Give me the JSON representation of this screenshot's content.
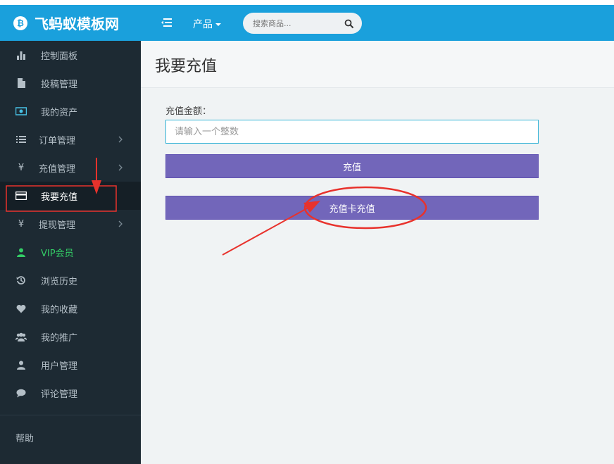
{
  "brand": {
    "logo_glyph": "₿",
    "name": "飞蚂蚁模板网"
  },
  "header": {
    "product_menu_label": "产品",
    "search": {
      "placeholder": "搜索商品...",
      "value": ""
    }
  },
  "sidebar": {
    "items": [
      {
        "label": "控制面板",
        "icon": "bar-chart-icon"
      },
      {
        "label": "投稿管理",
        "icon": "file-icon"
      },
      {
        "label": "我的资产",
        "icon": "money-icon"
      },
      {
        "label": "订单管理",
        "icon": "list-icon"
      },
      {
        "label": "充值管理",
        "icon": "yen-icon"
      },
      {
        "label": "我要充值",
        "icon": "credit-card-icon"
      },
      {
        "label": "提现管理",
        "icon": "yen-icon"
      },
      {
        "label": "VIP会员",
        "icon": "user-icon"
      },
      {
        "label": "浏览历史",
        "icon": "history-icon"
      },
      {
        "label": "我的收藏",
        "icon": "heart-icon"
      },
      {
        "label": "我的推广",
        "icon": "users-icon"
      },
      {
        "label": "用户管理",
        "icon": "user-icon"
      },
      {
        "label": "评论管理",
        "icon": "comment-icon"
      }
    ],
    "active_label": "我要充值",
    "yen_glyph": "¥",
    "help_label": "帮助"
  },
  "main": {
    "title": "我要充值",
    "amount_label": "充值金额：",
    "amount_placeholder": "请输入一个整数",
    "amount_value": "",
    "recharge_button": "充值",
    "card_recharge_button": "充值卡充值"
  },
  "colors": {
    "header_bg": "#1aa0dc",
    "sidebar_bg": "#1d2a33",
    "button_bg": "#7266ba",
    "vip_green": "#33cc66",
    "annotation_red": "#e8322c"
  }
}
